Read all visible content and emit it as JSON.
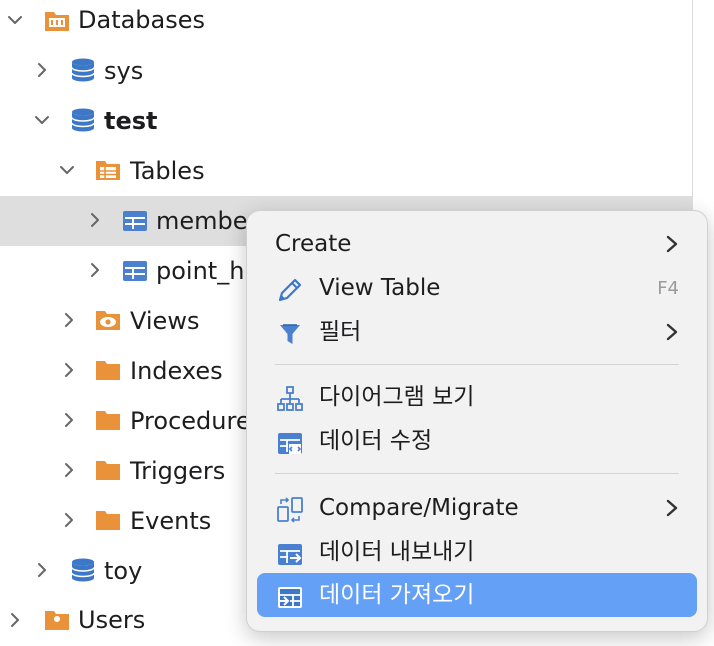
{
  "tree": {
    "items": [
      {
        "label": "Databases",
        "icon": "databases-folder-icon",
        "expanded": true
      },
      {
        "label": "sys",
        "icon": "database-icon",
        "expanded": false
      },
      {
        "label": "test",
        "icon": "database-icon",
        "expanded": true
      },
      {
        "label": "Tables",
        "icon": "tables-folder-icon",
        "expanded": true
      },
      {
        "label": "membe",
        "icon": "table-icon",
        "expanded": false,
        "selected": true
      },
      {
        "label": "point_h",
        "icon": "table-icon",
        "expanded": false
      },
      {
        "label": "Views",
        "icon": "views-folder-icon",
        "expanded": false
      },
      {
        "label": "Indexes",
        "icon": "folder-icon",
        "expanded": false
      },
      {
        "label": "Procedure",
        "icon": "folder-icon",
        "expanded": false
      },
      {
        "label": "Triggers",
        "icon": "folder-icon",
        "expanded": false
      },
      {
        "label": "Events",
        "icon": "folder-icon",
        "expanded": false
      },
      {
        "label": "toy",
        "icon": "database-icon",
        "expanded": false
      },
      {
        "label": "Users",
        "icon": "users-folder-icon",
        "expanded": false
      }
    ]
  },
  "context_menu": {
    "items": [
      {
        "label": "Create",
        "icon": "",
        "submenu": true
      },
      {
        "label": "View Table",
        "icon": "pencil-icon",
        "shortcut": "F4"
      },
      {
        "label": "필터",
        "icon": "filter-icon",
        "submenu": true
      },
      {
        "label": "다이어그램 보기",
        "icon": "diagram-icon"
      },
      {
        "label": "데이터 수정",
        "icon": "edit-data-icon"
      },
      {
        "label": "Compare/Migrate",
        "icon": "compare-migrate-icon",
        "submenu": true
      },
      {
        "label": "데이터 내보내기",
        "icon": "export-data-icon"
      },
      {
        "label": "데이터 가져오기",
        "icon": "import-data-icon",
        "highlighted": true
      }
    ]
  },
  "colors": {
    "folder": "#ea9239",
    "database": "#3d78c8",
    "table": "#4a80cf",
    "highlight": "#64a0f5",
    "selected_row": "#dedede"
  }
}
